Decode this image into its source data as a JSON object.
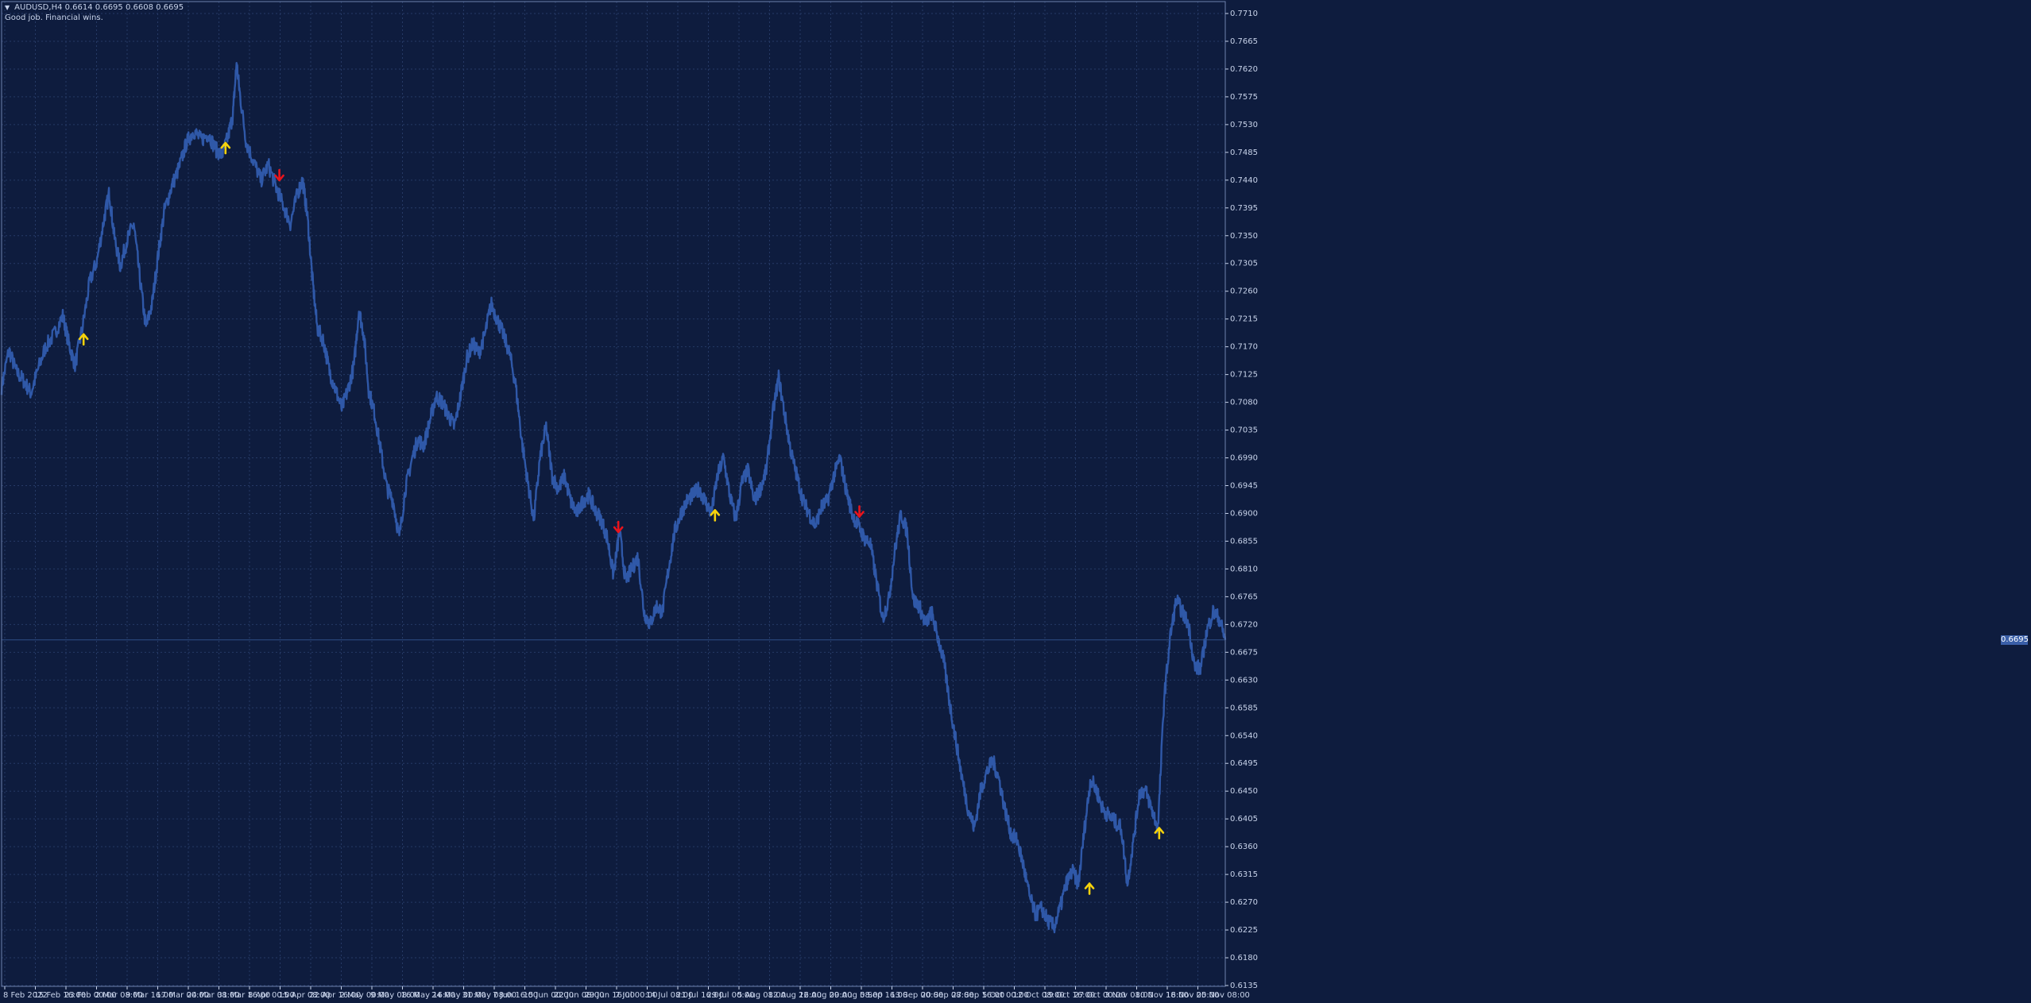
{
  "header": {
    "symbol_line": "AUDUSD,H4  0.6614 0.6695 0.6608 0.6695",
    "comment": "Good job. Financial wins."
  },
  "current_price": "0.6695",
  "icons": {
    "collapse": "triangle-down-icon",
    "buy": "yellow-up-arrow-icon",
    "sell": "red-down-arrow-icon"
  },
  "colors": {
    "background": "#0e1c3e",
    "grid": "#263a66",
    "price_series": "#2f58a8",
    "axis_text": "#c8d3ea",
    "bid_line": "#2f4e86",
    "buy_arrow": "#f5d20c",
    "sell_arrow": "#e8141c"
  },
  "chart_data": {
    "type": "line",
    "symbol": "AUDUSD",
    "timeframe": "H4",
    "grid": true,
    "y_ticks": [
      "0.7710",
      "0.7665",
      "0.7620",
      "0.7575",
      "0.7530",
      "0.7485",
      "0.7440",
      "0.7395",
      "0.7350",
      "0.7305",
      "0.7260",
      "0.7215",
      "0.7170",
      "0.7125",
      "0.7080",
      "0.7035",
      "0.6990",
      "0.6945",
      "0.6900",
      "0.6855",
      "0.6810",
      "0.6765",
      "0.6720",
      "0.6675",
      "0.6630",
      "0.6585",
      "0.6540",
      "0.6495",
      "0.6450",
      "0.6405",
      "0.6360",
      "0.6315",
      "0.6270",
      "0.6225",
      "0.6180",
      "0.6135"
    ],
    "x_ticks": [
      "8 Feb 2022",
      "15 Feb 16:00",
      "23 Feb 00:00",
      "2 Mar 08:00",
      "9 Mar 16:00",
      "17 Mar 00:00",
      "24 Mar 08:00",
      "31 Mar 16:00",
      "8 Apr 00:00",
      "15 Apr 08:00",
      "22 Apr 16:00",
      "2 May 00:00",
      "9 May 08:00",
      "16 May 16:00",
      "24 May 00:00",
      "31 May 08:00",
      "7 Jun 16:00",
      "15 Jun 00:00",
      "22 Jun 08:00",
      "29 Jun 16:00",
      "7 Jul 00:00",
      "14 Jul 08:00",
      "21 Jul 16:00",
      "29 Jul 00:00",
      "5 Aug 08:00",
      "12 Aug 16:00",
      "22 Aug 00:00",
      "29 Aug 08:00",
      "5 Sep 16:00",
      "13 Sep 00:00",
      "20 Sep 08:00",
      "27 Sep 16:00",
      "5 Oct 00:00",
      "12 Oct 08:00",
      "19 Oct 16:00",
      "27 Oct 00:00",
      "3 Nov 08:00",
      "10 Nov 16:00",
      "18 Nov 00:00",
      "25 Nov 08:00"
    ],
    "series": [
      {
        "values": [
          [
            0,
            0.7105
          ],
          [
            0.006,
            0.7165
          ],
          [
            0.012,
            0.713
          ],
          [
            0.018,
            0.7115
          ],
          [
            0.024,
            0.7095
          ],
          [
            0.03,
            0.7135
          ],
          [
            0.036,
            0.717
          ],
          [
            0.043,
            0.719
          ],
          [
            0.05,
            0.722
          ],
          [
            0.055,
            0.7175
          ],
          [
            0.06,
            0.714
          ],
          [
            0.066,
            0.72
          ],
          [
            0.072,
            0.7275
          ],
          [
            0.078,
            0.731
          ],
          [
            0.084,
            0.738
          ],
          [
            0.088,
            0.742
          ],
          [
            0.092,
            0.735
          ],
          [
            0.097,
            0.73
          ],
          [
            0.102,
            0.734
          ],
          [
            0.108,
            0.737
          ],
          [
            0.113,
            0.728
          ],
          [
            0.118,
            0.72
          ],
          [
            0.123,
            0.724
          ],
          [
            0.128,
            0.732
          ],
          [
            0.133,
            0.739
          ],
          [
            0.139,
            0.743
          ],
          [
            0.145,
            0.746
          ],
          [
            0.151,
            0.75
          ],
          [
            0.157,
            0.752
          ],
          [
            0.163,
            0.7505
          ],
          [
            0.169,
            0.7515
          ],
          [
            0.175,
            0.749
          ],
          [
            0.18,
            0.748
          ],
          [
            0.185,
            0.751
          ],
          [
            0.189,
            0.7545
          ],
          [
            0.192,
            0.763
          ],
          [
            0.195,
            0.7575
          ],
          [
            0.2,
            0.75
          ],
          [
            0.206,
            0.747
          ],
          [
            0.212,
            0.744
          ],
          [
            0.218,
            0.7465
          ],
          [
            0.224,
            0.743
          ],
          [
            0.23,
            0.74
          ],
          [
            0.236,
            0.737
          ],
          [
            0.242,
            0.742
          ],
          [
            0.246,
            0.744
          ],
          [
            0.25,
            0.738
          ],
          [
            0.254,
            0.728
          ],
          [
            0.258,
            0.72
          ],
          [
            0.263,
            0.718
          ],
          [
            0.268,
            0.713
          ],
          [
            0.273,
            0.71
          ],
          [
            0.278,
            0.707
          ],
          [
            0.283,
            0.71
          ],
          [
            0.288,
            0.714
          ],
          [
            0.292,
            0.723
          ],
          [
            0.296,
            0.719
          ],
          [
            0.3,
            0.71
          ],
          [
            0.305,
            0.706
          ],
          [
            0.31,
            0.7
          ],
          [
            0.315,
            0.694
          ],
          [
            0.32,
            0.692
          ],
          [
            0.325,
            0.686
          ],
          [
            0.33,
            0.694
          ],
          [
            0.335,
            0.6985
          ],
          [
            0.34,
            0.702
          ],
          [
            0.345,
            0.701
          ],
          [
            0.35,
            0.705
          ],
          [
            0.355,
            0.709
          ],
          [
            0.36,
            0.708
          ],
          [
            0.365,
            0.706
          ],
          [
            0.37,
            0.704
          ],
          [
            0.375,
            0.709
          ],
          [
            0.38,
            0.715
          ],
          [
            0.385,
            0.7175
          ],
          [
            0.39,
            0.716
          ],
          [
            0.395,
            0.719
          ],
          [
            0.4,
            0.724
          ],
          [
            0.405,
            0.7215
          ],
          [
            0.41,
            0.719
          ],
          [
            0.415,
            0.716
          ],
          [
            0.42,
            0.711
          ],
          [
            0.425,
            0.702
          ],
          [
            0.43,
            0.695
          ],
          [
            0.435,
            0.689
          ],
          [
            0.44,
            0.699
          ],
          [
            0.445,
            0.704
          ],
          [
            0.45,
            0.696
          ],
          [
            0.455,
            0.694
          ],
          [
            0.46,
            0.696
          ],
          [
            0.465,
            0.692
          ],
          [
            0.47,
            0.69
          ],
          [
            0.475,
            0.692
          ],
          [
            0.48,
            0.693
          ],
          [
            0.485,
            0.6905
          ],
          [
            0.49,
            0.689
          ],
          [
            0.495,
            0.686
          ],
          [
            0.5,
            0.68
          ],
          [
            0.505,
            0.687
          ],
          [
            0.51,
            0.679
          ],
          [
            0.515,
            0.681
          ],
          [
            0.52,
            0.683
          ],
          [
            0.525,
            0.674
          ],
          [
            0.53,
            0.672
          ],
          [
            0.535,
            0.675
          ],
          [
            0.54,
            0.674
          ],
          [
            0.545,
            0.681
          ],
          [
            0.55,
            0.687
          ],
          [
            0.555,
            0.69
          ],
          [
            0.56,
            0.692
          ],
          [
            0.565,
            0.693
          ],
          [
            0.57,
            0.694
          ],
          [
            0.575,
            0.692
          ],
          [
            0.58,
            0.69
          ],
          [
            0.585,
            0.696
          ],
          [
            0.59,
            0.699
          ],
          [
            0.595,
            0.693
          ],
          [
            0.6,
            0.689
          ],
          [
            0.605,
            0.695
          ],
          [
            0.61,
            0.697
          ],
          [
            0.615,
            0.692
          ],
          [
            0.62,
            0.694
          ],
          [
            0.625,
            0.697
          ],
          [
            0.63,
            0.706
          ],
          [
            0.635,
            0.712
          ],
          [
            0.64,
            0.706
          ],
          [
            0.645,
            0.7
          ],
          [
            0.65,
            0.696
          ],
          [
            0.655,
            0.692
          ],
          [
            0.66,
            0.69
          ],
          [
            0.665,
            0.688
          ],
          [
            0.67,
            0.691
          ],
          [
            0.675,
            0.692
          ],
          [
            0.68,
            0.696
          ],
          [
            0.685,
            0.699
          ],
          [
            0.69,
            0.694
          ],
          [
            0.695,
            0.69
          ],
          [
            0.7,
            0.688
          ],
          [
            0.705,
            0.686
          ],
          [
            0.71,
            0.685
          ],
          [
            0.715,
            0.679
          ],
          [
            0.72,
            0.673
          ],
          [
            0.725,
            0.676
          ],
          [
            0.73,
            0.684
          ],
          [
            0.735,
            0.69
          ],
          [
            0.74,
            0.687
          ],
          [
            0.745,
            0.676
          ],
          [
            0.75,
            0.675
          ],
          [
            0.755,
            0.672
          ],
          [
            0.76,
            0.674
          ],
          [
            0.765,
            0.67
          ],
          [
            0.77,
            0.666
          ],
          [
            0.775,
            0.659
          ],
          [
            0.78,
            0.653
          ],
          [
            0.785,
            0.647
          ],
          [
            0.79,
            0.642
          ],
          [
            0.795,
            0.639
          ],
          [
            0.8,
            0.645
          ],
          [
            0.805,
            0.648
          ],
          [
            0.81,
            0.65
          ],
          [
            0.815,
            0.647
          ],
          [
            0.82,
            0.642
          ],
          [
            0.825,
            0.638
          ],
          [
            0.83,
            0.637
          ],
          [
            0.835,
            0.633
          ],
          [
            0.84,
            0.628
          ],
          [
            0.845,
            0.625
          ],
          [
            0.85,
            0.626
          ],
          [
            0.855,
            0.624
          ],
          [
            0.86,
            0.623
          ],
          [
            0.865,
            0.626
          ],
          [
            0.87,
            0.63
          ],
          [
            0.875,
            0.632
          ],
          [
            0.88,
            0.63
          ],
          [
            0.885,
            0.639
          ],
          [
            0.89,
            0.647
          ],
          [
            0.895,
            0.645
          ],
          [
            0.9,
            0.642
          ],
          [
            0.905,
            0.641
          ],
          [
            0.91,
            0.64
          ],
          [
            0.915,
            0.639
          ],
          [
            0.92,
            0.63
          ],
          [
            0.925,
            0.637
          ],
          [
            0.93,
            0.645
          ],
          [
            0.935,
            0.645
          ],
          [
            0.94,
            0.642
          ],
          [
            0.945,
            0.639
          ],
          [
            0.95,
            0.66
          ],
          [
            0.955,
            0.67
          ],
          [
            0.96,
            0.676
          ],
          [
            0.965,
            0.674
          ],
          [
            0.97,
            0.672
          ],
          [
            0.975,
            0.665
          ],
          [
            0.98,
            0.665
          ],
          [
            0.985,
            0.671
          ],
          [
            0.99,
            0.674
          ],
          [
            0.995,
            0.673
          ],
          [
            1.0,
            0.6695
          ]
        ]
      }
    ],
    "signals": [
      {
        "type": "buy",
        "t": 0.067,
        "price": 0.718
      },
      {
        "type": "buy",
        "t": 0.183,
        "price": 0.749
      },
      {
        "type": "sell",
        "t": 0.227,
        "price": 0.745
      },
      {
        "type": "sell",
        "t": 0.504,
        "price": 0.688
      },
      {
        "type": "buy",
        "t": 0.583,
        "price": 0.6895
      },
      {
        "type": "sell",
        "t": 0.701,
        "price": 0.6905
      },
      {
        "type": "buy",
        "t": 0.889,
        "price": 0.629
      },
      {
        "type": "buy",
        "t": 0.946,
        "price": 0.638
      }
    ]
  }
}
